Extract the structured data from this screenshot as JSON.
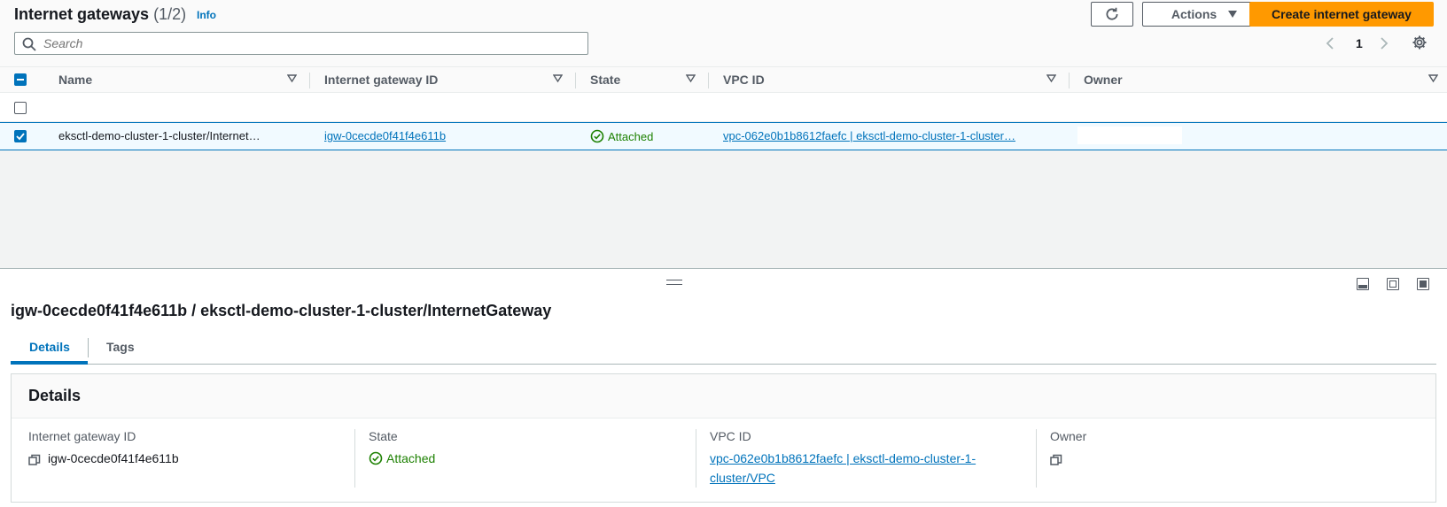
{
  "header": {
    "title": "Internet gateways",
    "count": "(1/2)",
    "info": "Info",
    "actions_label": "Actions",
    "create_label": "Create internet gateway",
    "search_placeholder": "Search",
    "page_number": "1"
  },
  "table": {
    "columns": [
      "Name",
      "Internet gateway ID",
      "State",
      "VPC ID",
      "Owner"
    ],
    "rows": [
      {
        "selected": true,
        "name": "eksctl-demo-cluster-1-cluster/Internet…",
        "igw_id": "igw-0cecde0f41f4e611b",
        "state": "Attached",
        "vpc_id": "vpc-062e0b1b8612faefc | eksctl-demo-cluster-1-cluster…",
        "owner": ""
      }
    ]
  },
  "split_panel": {
    "title": "igw-0cecde0f41f4e611b / eksctl-demo-cluster-1-cluster/InternetGateway",
    "tabs": [
      "Details",
      "Tags"
    ],
    "active_tab": "Details",
    "details": {
      "heading": "Details",
      "fields": [
        {
          "label": "Internet gateway ID",
          "value": "igw-0cecde0f41f4e611b"
        },
        {
          "label": "State",
          "value": "Attached"
        },
        {
          "label": "VPC ID",
          "value_line1": "vpc-062e0b1b8612faefc | eksctl-demo-cluster-1-",
          "value_line2": "cluster/VPC"
        },
        {
          "label": "Owner",
          "value": ""
        }
      ]
    }
  },
  "colors": {
    "accent": "#0073bb",
    "primary_button": "#ff9900",
    "success": "#1d8102",
    "selected_row_bg": "#f1faff"
  },
  "icons": [
    "refresh-icon",
    "caret-down-icon",
    "search-icon",
    "chevron-left-icon",
    "chevron-right-icon",
    "settings-gear-icon",
    "sort-icon",
    "check-icon",
    "status-success-icon",
    "copy-icon",
    "panel-bottom-icon",
    "panel-side-icon",
    "panel-full-icon",
    "drag-handle-icon"
  ]
}
